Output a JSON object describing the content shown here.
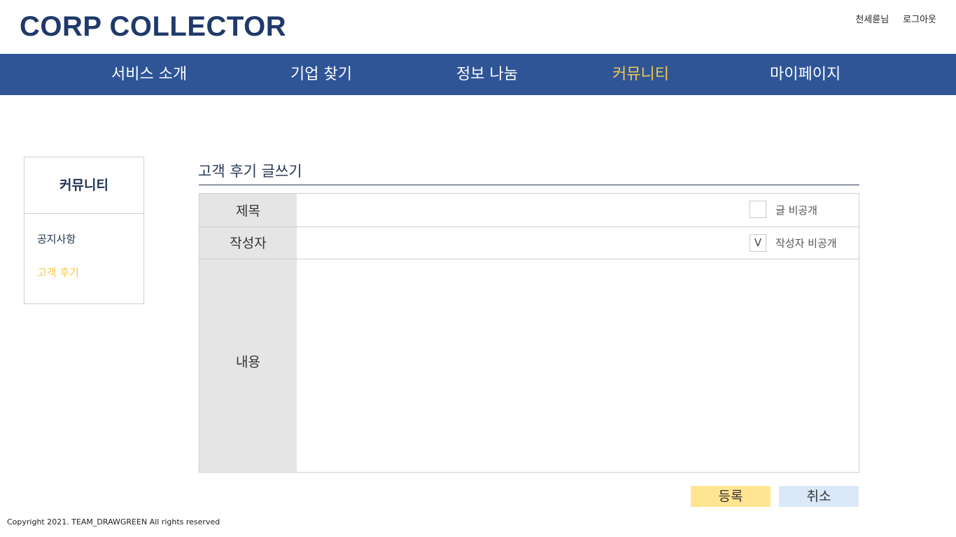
{
  "header": {
    "logo": "CORP COLLECTOR",
    "user_name": "천세륜님",
    "logout": "로그아웃"
  },
  "nav": {
    "items": [
      "서비스 소개",
      "기업 찾기",
      "정보 나눔",
      "커뮤니티",
      "마이페이지"
    ],
    "active": "커뮤니티"
  },
  "sidebar": {
    "title": "커뮤니티",
    "items": [
      "공지사항",
      "고객 후기"
    ],
    "active": "고객 후기"
  },
  "main": {
    "title": "고객 후기 글쓰기",
    "form": {
      "title_label": "제목",
      "title_value": "",
      "private_post_label": "글 비공개",
      "private_post_checked": false,
      "author_label": "작성자",
      "author_value": "",
      "private_author_label": "작성자 비공개",
      "private_author_checked": true,
      "private_author_mark": "V",
      "content_label": "내용",
      "content_value": ""
    },
    "submit_label": "등록",
    "cancel_label": "취소"
  },
  "footer": {
    "copyright": "Copyright 2021. TEAM_DRAWGREEN All rights reserved"
  },
  "colors": {
    "brand_navy": "#1f3a6a",
    "nav_bg": "#2f5597",
    "accent_yellow": "#f3c94a",
    "submit_bg": "#ffe592",
    "cancel_bg": "#dae8f7",
    "label_bg": "#e5e5e5"
  }
}
